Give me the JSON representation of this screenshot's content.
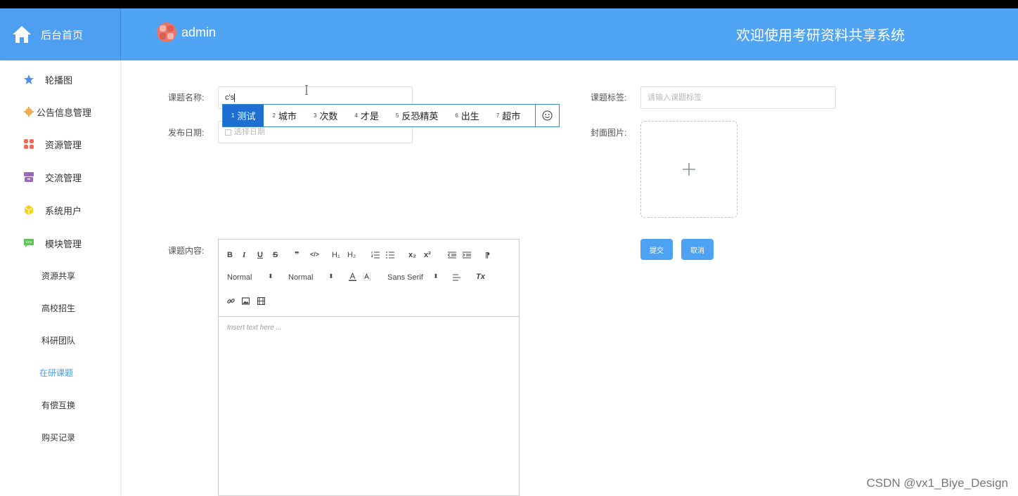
{
  "header": {
    "home_label": "后台首页",
    "user_name": "admin",
    "welcome": "欢迎使用考研资料共享系统",
    "color": "#50a4f4"
  },
  "sidebar": {
    "items": [
      {
        "label": "轮播图",
        "icon": "star-icon",
        "color": "#4e8fe8"
      },
      {
        "label": "公告信息管理",
        "icon": "gear-icon",
        "color": "#f0a94a"
      },
      {
        "label": "资源管理",
        "icon": "grid-icon",
        "color": "#ee6a5c"
      },
      {
        "label": "交流管理",
        "icon": "archive-icon",
        "color": "#9b69b8"
      },
      {
        "label": "系统用户",
        "icon": "cube-icon",
        "color": "#f5d316"
      },
      {
        "label": "模块管理",
        "icon": "chat-icon",
        "color": "#62c35a"
      }
    ],
    "sub_items": [
      "资源共享",
      "高校招生",
      "科研团队",
      "在研课题",
      "有偿互换",
      "购买记录"
    ],
    "active_sub": "在研课题",
    "active_color": "#409eff"
  },
  "form": {
    "name_label": "课题名称:",
    "name_value": "c's",
    "tag_label": "课题标签:",
    "tag_placeholder": "请输入课题标签",
    "date_label": "发布日期:",
    "date_placeholder": "选择日期",
    "cover_label": "封面图片:",
    "content_label": "课题内容:",
    "submit": "提交",
    "cancel": "取消"
  },
  "ime": {
    "candidates": [
      {
        "n": "1",
        "text": "测试"
      },
      {
        "n": "2",
        "text": "城市"
      },
      {
        "n": "3",
        "text": "次数"
      },
      {
        "n": "4",
        "text": "才是"
      },
      {
        "n": "5",
        "text": "反恐精英"
      },
      {
        "n": "6",
        "text": "出生"
      },
      {
        "n": "7",
        "text": "超市"
      }
    ],
    "selected_color": "#1d6fd1"
  },
  "editor": {
    "header_picker": "Normal",
    "size_picker": "Normal",
    "font_picker": "Sans Serif",
    "placeholder": "Insert text here ...",
    "bold": "B",
    "italic": "I",
    "underline": "U",
    "strike": "S",
    "quote": "❞",
    "code": "</>",
    "h1": "H₁",
    "h2": "H₂",
    "sub": "x₂",
    "sup": "x²",
    "dir": "⁋",
    "clean": "Tx"
  },
  "watermark": "CSDN @vx1_Biye_Design"
}
